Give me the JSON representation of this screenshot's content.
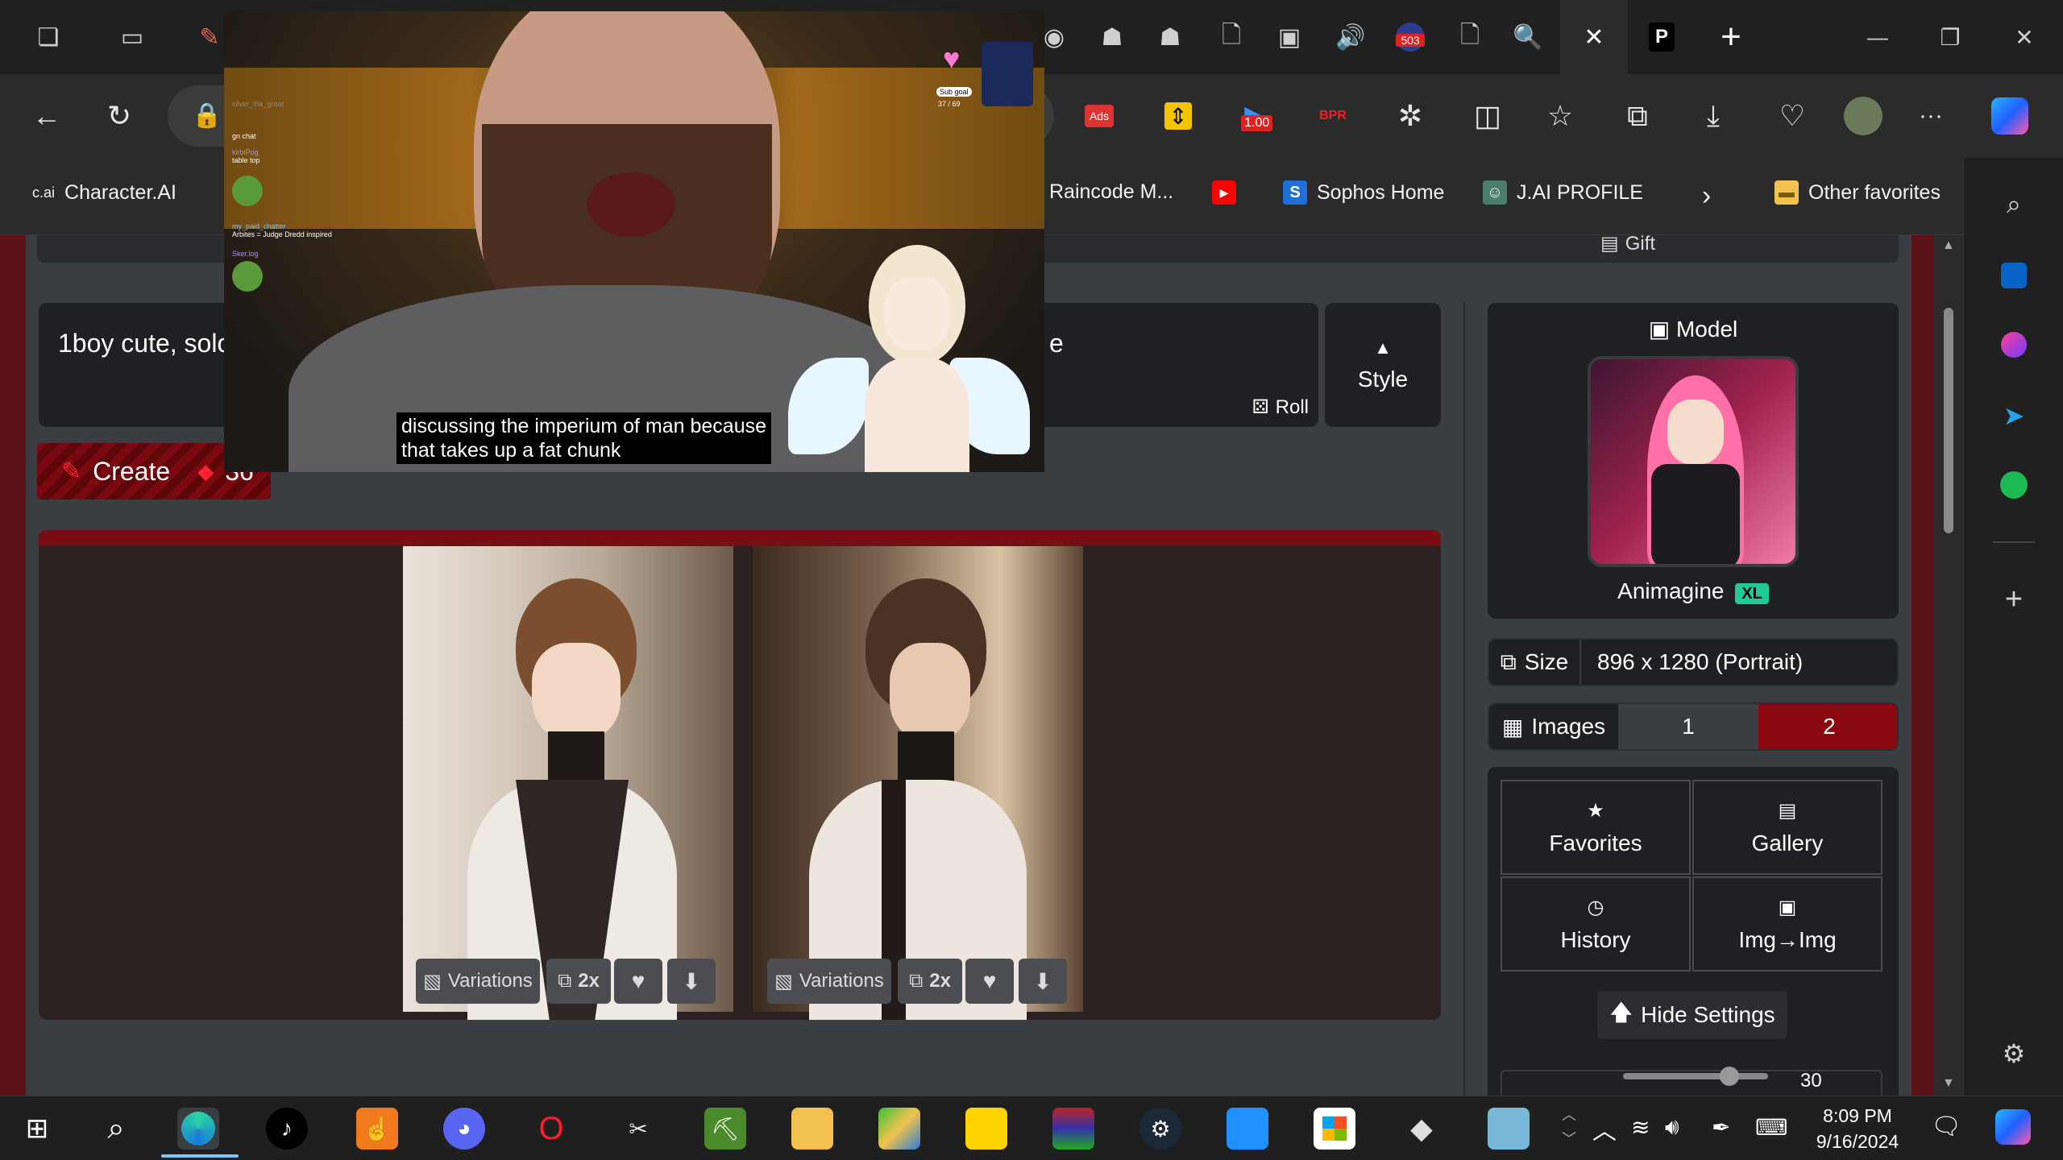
{
  "tabbar": {
    "new_tab_label": "+",
    "minimize": "—",
    "restore": "❐",
    "close": "✕",
    "badge_count": "503"
  },
  "toolbar": {
    "extension_badge": "1.00",
    "ext_ads": "Ads",
    "ext_bpr": "BPR",
    "more": "···"
  },
  "favorites": [
    {
      "label": "Character.AI",
      "icon": "c.ai"
    },
    {
      "label": "Raincode M...",
      "icon": ""
    },
    {
      "label": "",
      "icon": "youtube-icon"
    },
    {
      "label": "Sophos Home",
      "icon": "S"
    },
    {
      "label": "J.AI PROFILE",
      "icon": ""
    },
    {
      "label": "Other favorites",
      "icon": "folder"
    }
  ],
  "page": {
    "gift_label": "Gift",
    "prompt_text": "1boy cute, solo",
    "prompt_tail": "e",
    "roll_label": "Roll",
    "style_label": "Style",
    "create_label": "Create",
    "create_cost": "36",
    "model_header": "Model",
    "model_name": "Animagine",
    "model_badge": "XL",
    "size_label": "Size",
    "size_value": "896 x 1280 (Portrait)",
    "images_label": "Images",
    "images_options": [
      "1",
      "2"
    ],
    "grid": {
      "favorites": "Favorites",
      "gallery": "Gallery",
      "history": "History",
      "img2img": "Img→Img"
    },
    "hide_settings": "Hide Settings",
    "slider_value": "30",
    "image_actions": {
      "variations": "Variations",
      "upscale": "2x"
    }
  },
  "overlay": {
    "caption_line1": "discussing the imperium of man because",
    "caption_line2": "that takes up a fat chunk",
    "sub_goal": "Sub goal",
    "sub_count": "37 / 69",
    "chat": [
      {
        "user": "silver_the_great",
        "msg": ""
      },
      {
        "user": "",
        "msg": "gn chat"
      },
      {
        "user": "kirbiPog",
        "msg": "table top"
      },
      {
        "user": "my_paid_chatter",
        "msg": "Arbites = Judge Dredd inspired"
      },
      {
        "user": "Sker.log",
        "msg": ""
      }
    ]
  },
  "taskbar": {
    "time": "8:09 PM",
    "date": "9/16/2024"
  },
  "colors": {
    "accent_red": "#8b0a0f",
    "panel_bg": "#1f2023",
    "content_bg": "#3a3d42",
    "badge_green": "#20c997"
  }
}
